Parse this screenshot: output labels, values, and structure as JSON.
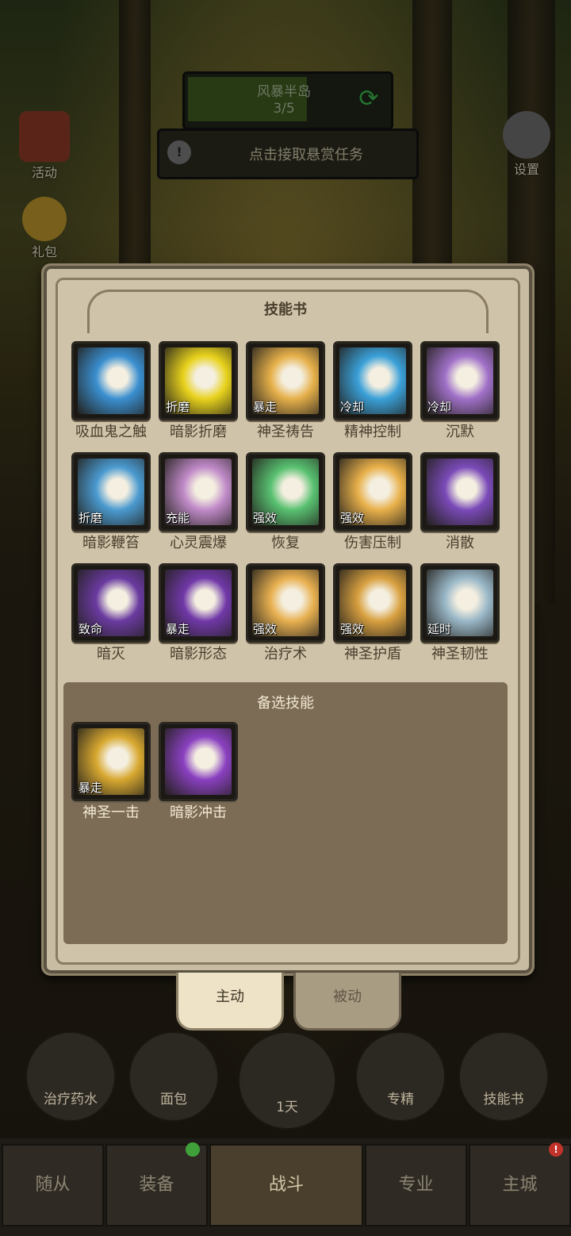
{
  "hud": {
    "area_name": "风暴半岛",
    "area_progress": "3/5",
    "quest_text": "点击接取悬赏任务",
    "left_buttons": [
      {
        "label": "活动"
      },
      {
        "label": "礼包"
      }
    ],
    "settings_label": "设置"
  },
  "skill_book": {
    "title": "技能书",
    "equipped": [
      {
        "name": "吸血鬼之触",
        "tag": "",
        "color": "#3a8fd0"
      },
      {
        "name": "暗影折磨",
        "tag": "折磨",
        "color": "#e8d21c"
      },
      {
        "name": "神圣祷告",
        "tag": "暴走",
        "color": "#e6b04a"
      },
      {
        "name": "精神控制",
        "tag": "冷却",
        "color": "#3aa0d8"
      },
      {
        "name": "沉默",
        "tag": "冷却",
        "color": "#a070c8"
      },
      {
        "name": "暗影鞭笞",
        "tag": "折磨",
        "color": "#4a9ad0"
      },
      {
        "name": "心灵震爆",
        "tag": "充能",
        "color": "#c08ac8"
      },
      {
        "name": "恢复",
        "tag": "强效",
        "color": "#58c070"
      },
      {
        "name": "伤害压制",
        "tag": "强效",
        "color": "#e8b04a"
      },
      {
        "name": "消散",
        "tag": "",
        "color": "#7a4ab8"
      },
      {
        "name": "暗灭",
        "tag": "致命",
        "color": "#6a3aa0"
      },
      {
        "name": "暗影形态",
        "tag": "暴走",
        "color": "#7038a8"
      },
      {
        "name": "治疗术",
        "tag": "强效",
        "color": "#e8b050"
      },
      {
        "name": "神圣护盾",
        "tag": "强效",
        "color": "#d8a040"
      },
      {
        "name": "神圣韧性",
        "tag": "延时",
        "color": "#9ab8c8"
      }
    ],
    "spare_title": "备选技能",
    "spare": [
      {
        "name": "神圣一击",
        "tag": "暴走",
        "color": "#d8a830"
      },
      {
        "name": "暗影冲击",
        "tag": "",
        "color": "#8a40c0"
      }
    ],
    "tabs": {
      "active": "主动",
      "passive": "被动"
    }
  },
  "quick_slots": [
    {
      "label": "治疗药水"
    },
    {
      "label": "面包"
    },
    {
      "label": "1天"
    },
    {
      "label": "专精"
    },
    {
      "label": "技能书"
    }
  ],
  "bottom_tabs": [
    {
      "label": "随从"
    },
    {
      "label": "装备"
    },
    {
      "label": "战斗"
    },
    {
      "label": "专业"
    },
    {
      "label": "主城"
    }
  ],
  "badges": {
    "main_city": "!"
  }
}
